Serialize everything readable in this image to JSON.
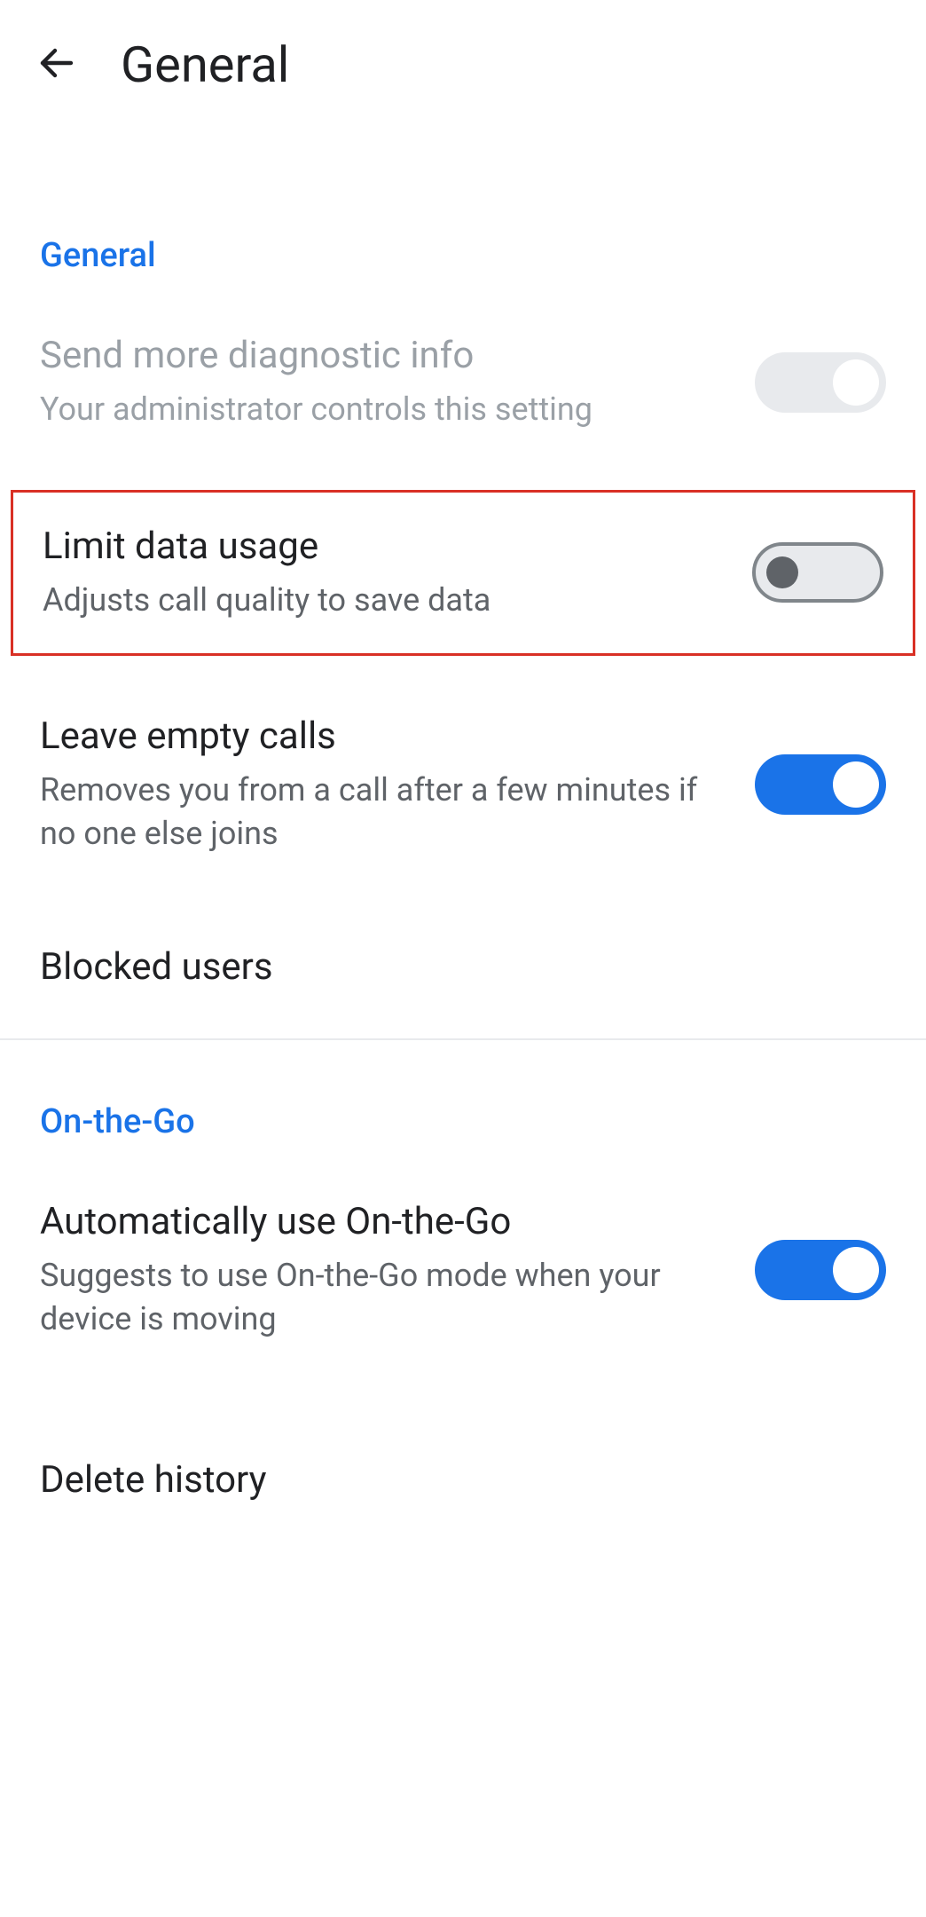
{
  "header": {
    "title": "General"
  },
  "sections": {
    "general": {
      "label": "General",
      "items": {
        "diagnostic": {
          "title": "Send more diagnostic info",
          "description": "Your administrator controls this setting"
        },
        "limitData": {
          "title": "Limit data usage",
          "description": "Adjusts call quality to save data"
        },
        "leaveEmpty": {
          "title": "Leave empty calls",
          "description": "Removes you from a call after a few minutes if no one else joins"
        },
        "blockedUsers": {
          "title": "Blocked users"
        }
      }
    },
    "onTheGo": {
      "label": "On-the-Go",
      "items": {
        "autoOnTheGo": {
          "title": "Automatically use On-the-Go",
          "description": "Suggests to use On-the-Go mode when your device is moving"
        },
        "deleteHistory": {
          "title": "Delete history"
        }
      }
    }
  }
}
